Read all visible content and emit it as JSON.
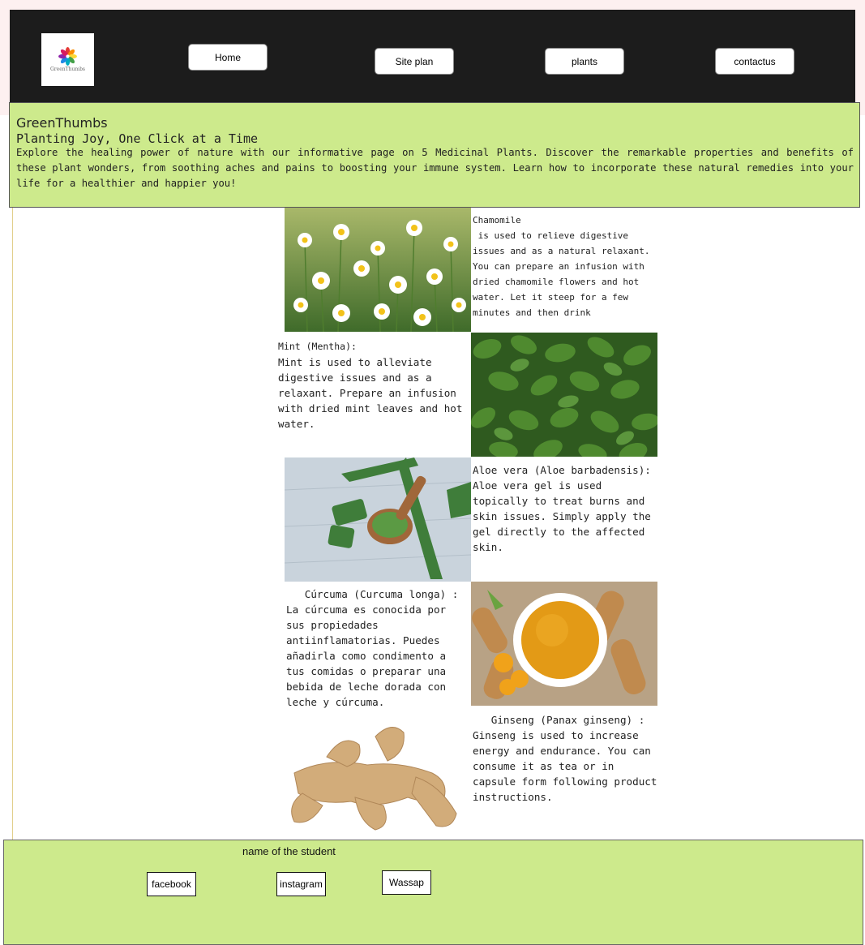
{
  "nav": {
    "logo_text": "GreenThumbs",
    "items": [
      {
        "label": "Home"
      },
      {
        "label": "Site plan"
      },
      {
        "label": "plants"
      },
      {
        "label": "contactus"
      }
    ]
  },
  "hero": {
    "brand": "GreenThumbs",
    "tagline": "Planting Joy, One Click at a Time",
    "intro": "Explore the healing power of nature with our informative page on 5 Medicinal Plants. Discover the remarkable properties and benefits of these plant wonders, from soothing aches and pains to boosting your immune system. Learn how to incorporate these natural remedies into your life for a healthier and happier you!"
  },
  "plants": [
    {
      "title": "Chamomile",
      "body": " is used to relieve digestive issues and as a natural relaxant. You can prepare an infusion with dried chamomile flowers and hot water. Let it steep for a few minutes and then drink"
    },
    {
      "title": "Mint (Mentha):",
      "body": "Mint is used to alleviate digestive issues and as a relaxant. Prepare an infusion with dried mint leaves and hot water."
    },
    {
      "title": "Aloe vera (Aloe barbadensis):",
      "body": "Aloe vera gel is used topically to treat burns and skin issues. Simply apply the gel directly to the affected skin."
    },
    {
      "title": "   Cúrcuma (Curcuma longa) :",
      "body": "La cúrcuma es conocida por sus propiedades antiinflamatorias. Puedes añadirla como condimento a tus comidas o preparar una bebida de leche dorada con leche y cúrcuma."
    },
    {
      "title": "   Ginseng (Panax ginseng) :",
      "body": "Ginseng is used to increase energy and endurance. You can consume it as tea or in capsule form following product instructions."
    }
  ],
  "footer": {
    "student": "name of the student",
    "links": [
      {
        "label": "facebook"
      },
      {
        "label": "instagram"
      },
      {
        "label": "Wassap"
      }
    ]
  },
  "colors": {
    "nav_bg": "#1c1c1c",
    "hero_bg": "#cdea8c",
    "footer_bg": "#cdea8c"
  }
}
